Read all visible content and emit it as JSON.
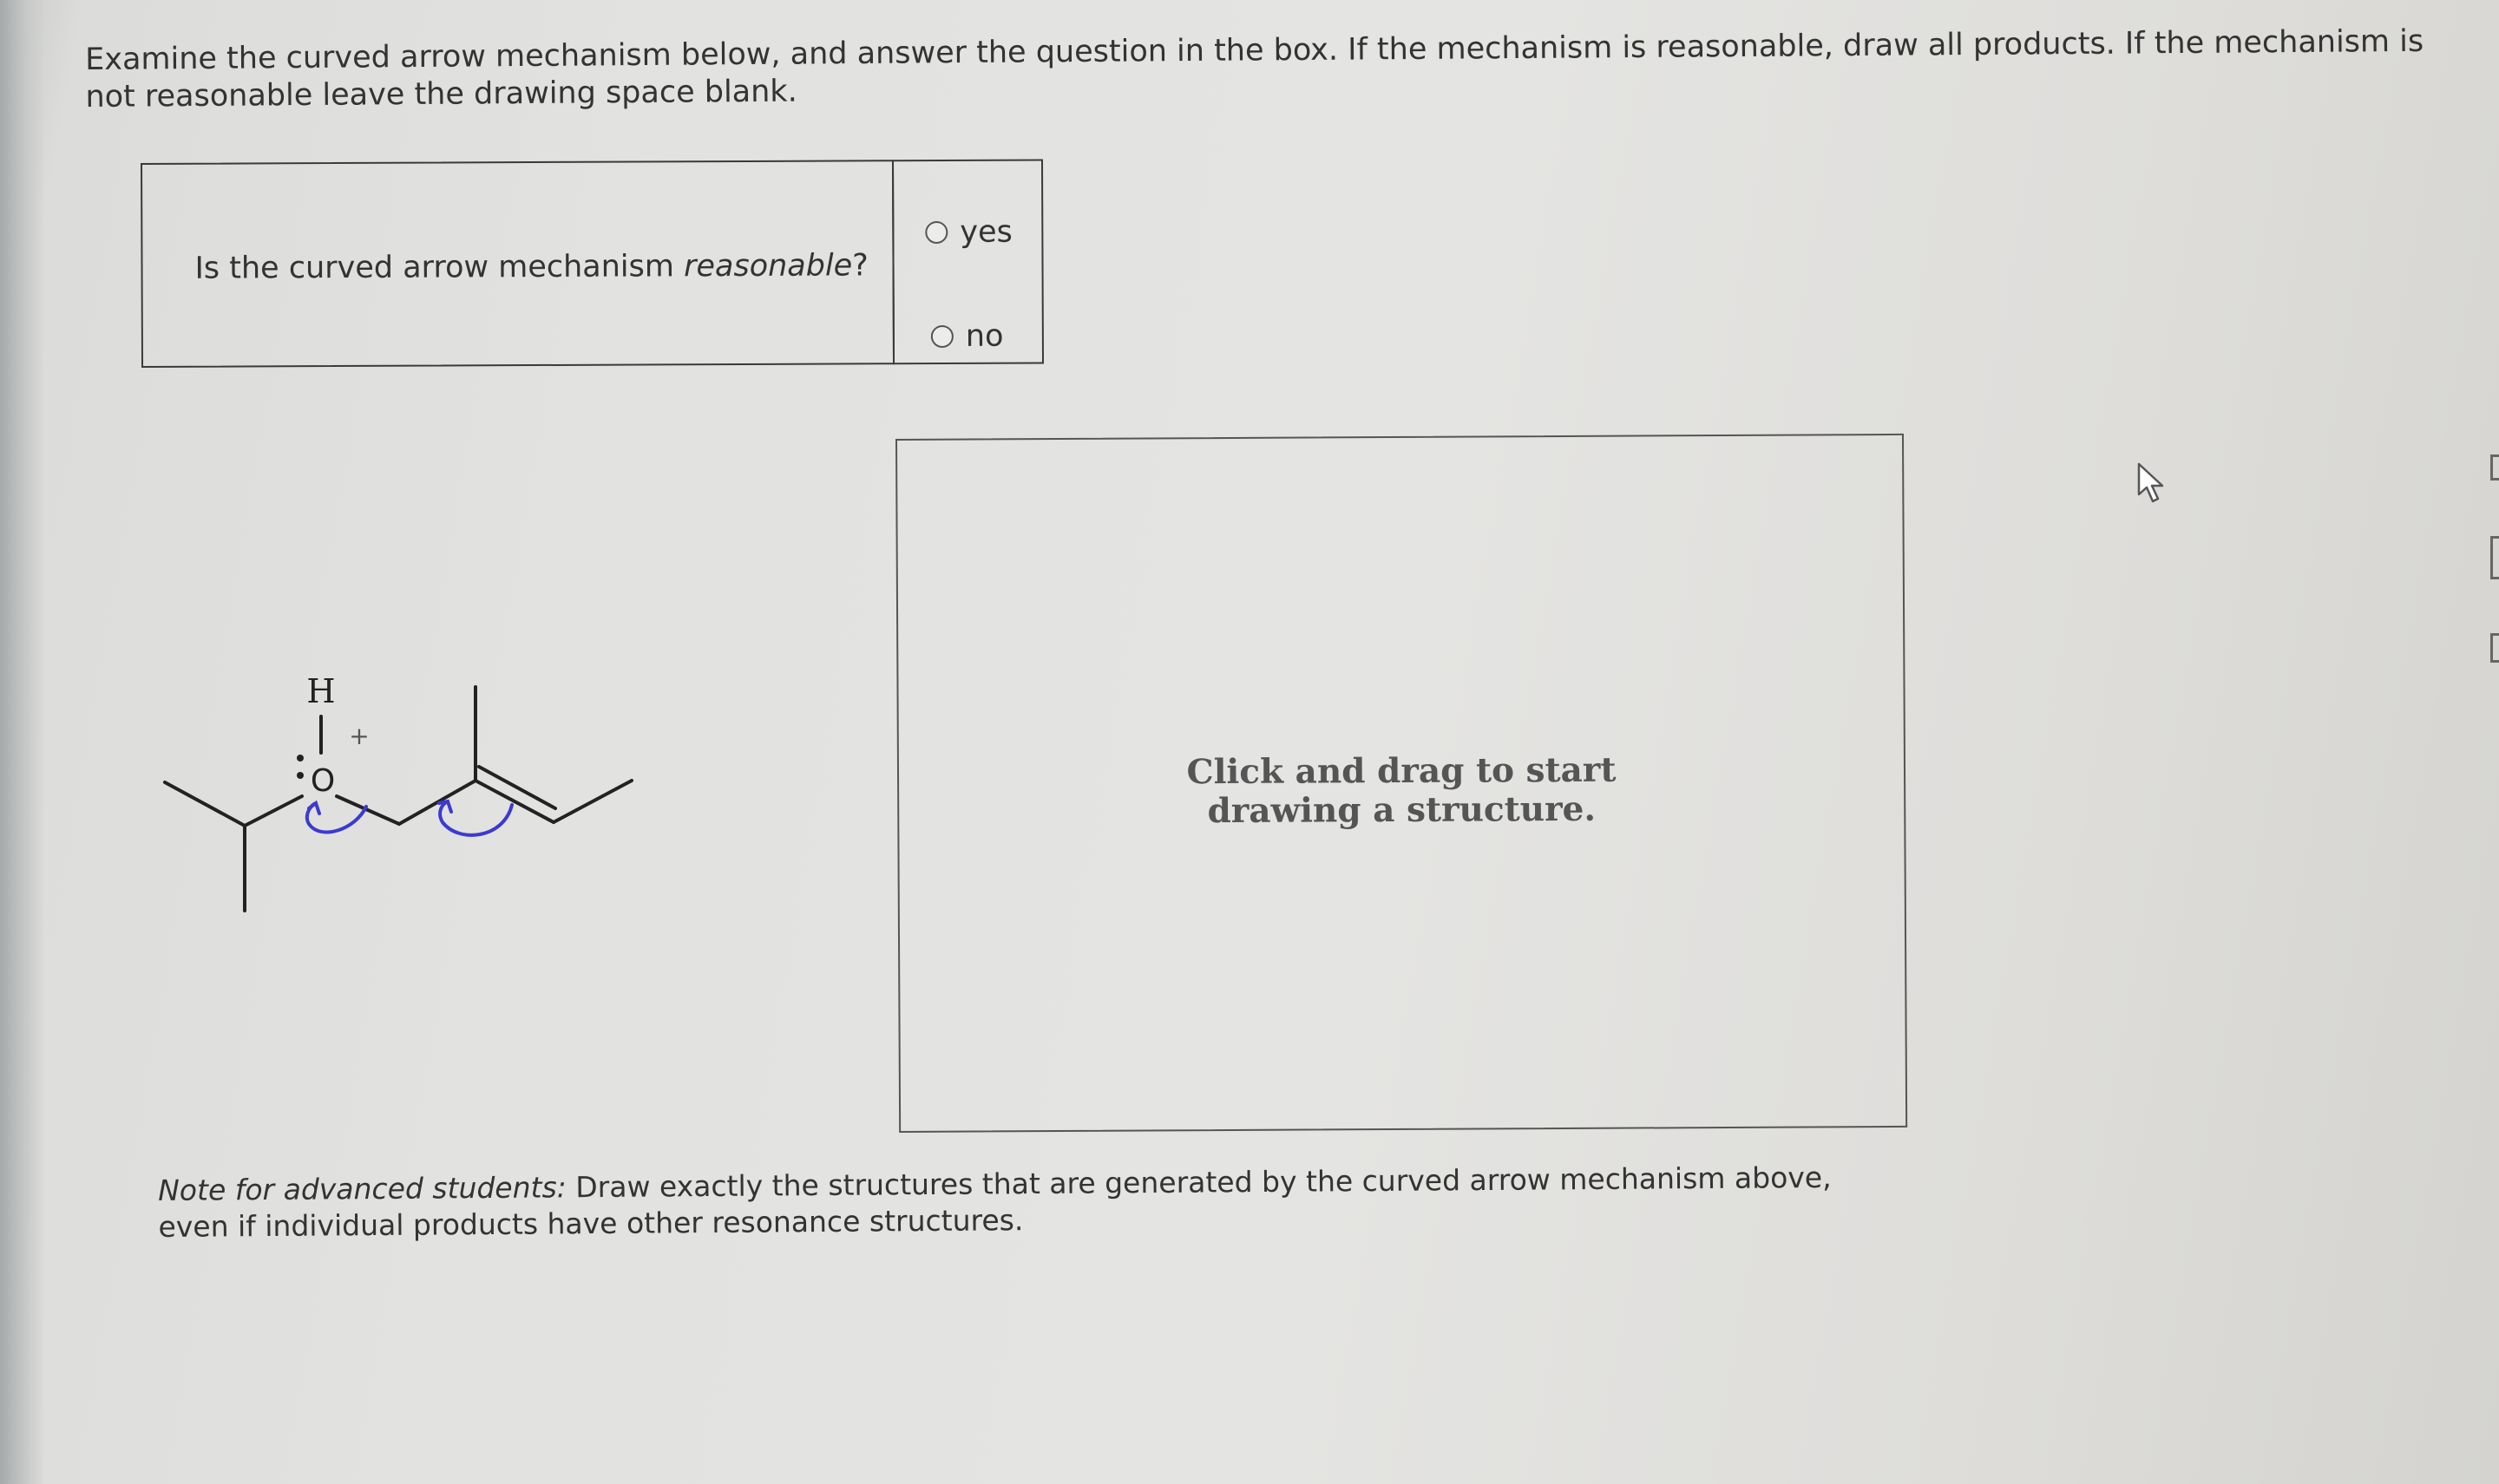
{
  "instructions": "Examine the curved arrow mechanism below, and answer the question in the box. If the mechanism is reasonable, draw all products. If the mechanism is not reasonable leave the drawing space blank.",
  "question": {
    "prefix": "Is the curved arrow mechanism ",
    "emphasis": "reasonable",
    "suffix": "?"
  },
  "options": [
    {
      "label": "yes",
      "selected": false
    },
    {
      "label": "no",
      "selected": false
    }
  ],
  "molecule": {
    "hydrogen_label": "H",
    "oxygen_label": "O",
    "charge_label": "+",
    "bond_color": "#222222",
    "arrow_color": "#3b3bcf"
  },
  "drawing_area": {
    "hint_line1": "Click and drag to start",
    "hint_line2": "drawing a structure."
  },
  "note": {
    "label": "Note for advanced students:",
    "text": " Draw exactly the structures that are generated by the curved arrow mechanism above, even if individual products have other resonance structures."
  }
}
